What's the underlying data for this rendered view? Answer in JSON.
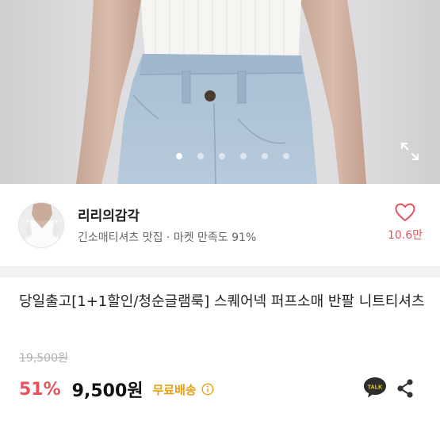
{
  "gallery": {
    "slides": [
      1,
      2,
      3,
      4,
      5,
      6
    ],
    "active_index": 0,
    "expand_icon": "expand-icon"
  },
  "shop": {
    "name": "리리의감각",
    "description": "긴소매티셔츠 맛집 · 마켓 만족도 91%",
    "like_count": "10.6만",
    "heart_icon": "heart-outline-icon"
  },
  "product": {
    "title": "당일출고[1+1할인/청순글램룩] 스퀘어넥 퍼프소매 반팔 니트티셔츠",
    "original_price": "19,500원",
    "discount": "51%",
    "price": "9,500원",
    "shipping": "무료배송",
    "talk_label": "TALK"
  },
  "colors": {
    "accent": "#e8535b",
    "shipping": "#e7a014",
    "kakao": "#2d2d2d"
  }
}
